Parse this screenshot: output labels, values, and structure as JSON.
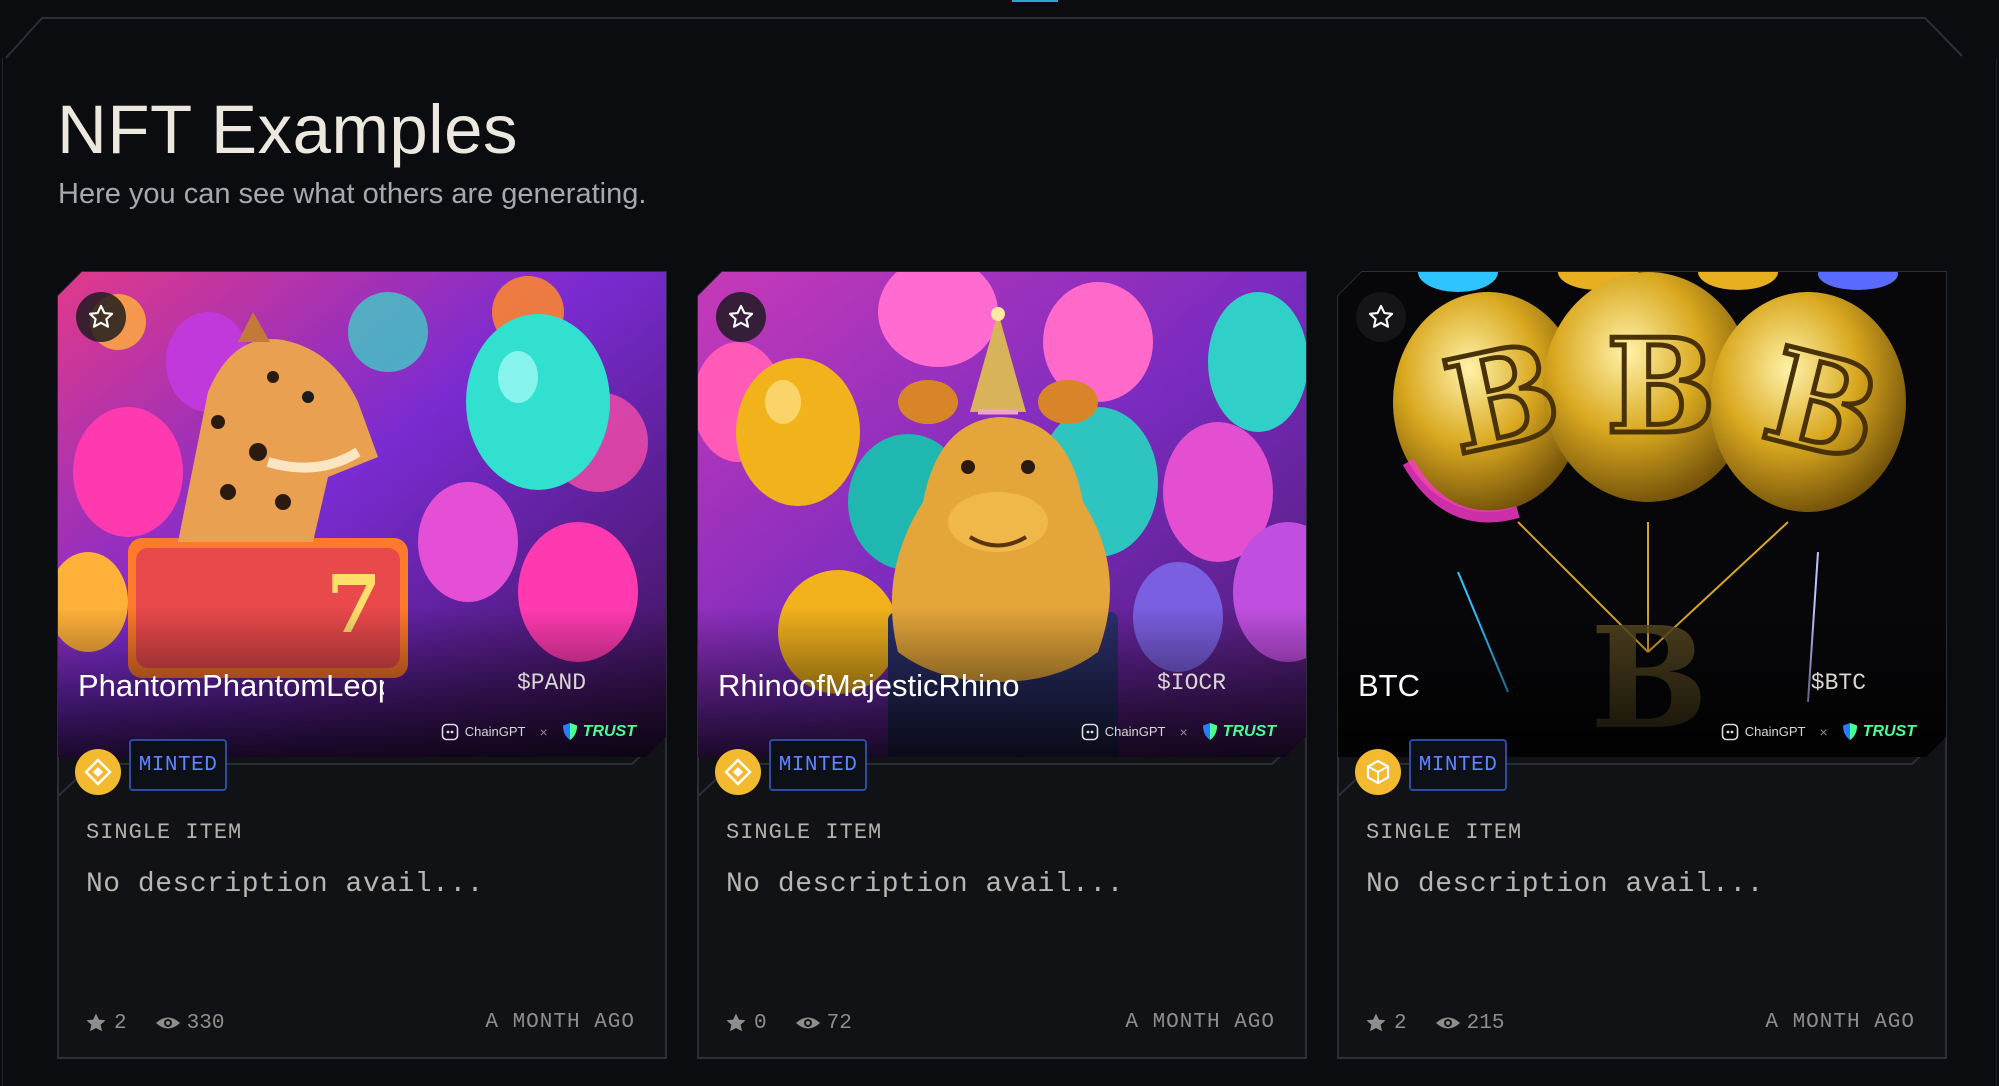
{
  "header": {
    "title": "NFT Examples",
    "subtitle": "Here you can see what others are generating."
  },
  "colors": {
    "background": "#0b0c10",
    "card_border": "#2b2e36",
    "minted_text": "#5c86ff",
    "minted_border": "#2b4ca3",
    "bnb_yellow": "#f3ba2f",
    "trust_green": "#48ff91"
  },
  "partners": {
    "chaingpt": "ChainGPT",
    "separator": "×",
    "trust": "TRUST"
  },
  "cards": [
    {
      "name": "PhantomPhantomLeop",
      "ticker": "$PAND",
      "status": "MINTED",
      "type": "SINGLE ITEM",
      "description": "No description avail...",
      "stars": "2",
      "views": "330",
      "time": "A MONTH AGO",
      "image": "leopard-with-balloons",
      "chain_icon": "bnb-diamond-icon"
    },
    {
      "name": "RhinoofMajesticRhino",
      "ticker": "$IOCR",
      "status": "MINTED",
      "type": "SINGLE ITEM",
      "description": "No description avail...",
      "stars": "0",
      "views": "72",
      "time": "A MONTH AGO",
      "image": "rhino-with-party-hat",
      "chain_icon": "bnb-diamond-icon"
    },
    {
      "name": "BTC",
      "ticker": "$BTC",
      "status": "MINTED",
      "type": "SINGLE ITEM",
      "description": "No description avail...",
      "stars": "2",
      "views": "215",
      "time": "A MONTH AGO",
      "image": "bitcoin-balloons",
      "chain_icon": "bnb-cube-icon"
    }
  ]
}
